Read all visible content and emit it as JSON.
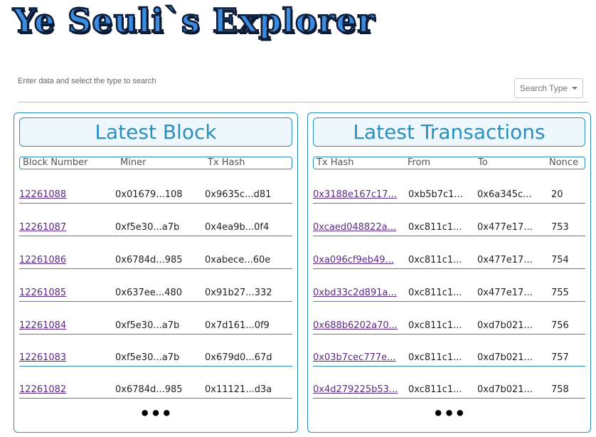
{
  "logo": "Ye Seuli`s Explorer",
  "search": {
    "hint": "Enter data and select the type to search",
    "type_label": "Search Type"
  },
  "blocks": {
    "title": "Latest Block",
    "headers": [
      "Block Number",
      "Miner",
      "Tx Hash"
    ],
    "rows": [
      {
        "number": "12261088",
        "miner": "0x01679...108",
        "tx": "0x9635c...d81"
      },
      {
        "number": "12261087",
        "miner": "0xf5e30...a7b",
        "tx": "0x4ea9b...0f4"
      },
      {
        "number": "12261086",
        "miner": "0x6784d...985",
        "tx": "0xabece...60e"
      },
      {
        "number": "12261085",
        "miner": "0x637ee...480",
        "tx": "0x91b27...332"
      },
      {
        "number": "12261084",
        "miner": "0xf5e30...a7b",
        "tx": "0x7d161...0f9"
      },
      {
        "number": "12261083",
        "miner": "0xf5e30...a7b",
        "tx": "0x679d0...67d"
      },
      {
        "number": "12261082",
        "miner": "0x6784d...985",
        "tx": "0x11121...d3a"
      }
    ],
    "more": "•••"
  },
  "transactions": {
    "title": "Latest Transactions",
    "headers": [
      "Tx Hash",
      "From",
      "To",
      "Nonce"
    ],
    "rows": [
      {
        "hash": "0x3188e167c17...",
        "from": "0xb5b7c1...",
        "to": "0x6a345c...",
        "nonce": "20"
      },
      {
        "hash": "0xcaed048822a...",
        "from": "0xc811c1...",
        "to": "0x477e17...",
        "nonce": "753"
      },
      {
        "hash": "0xa096cf9eb49...",
        "from": "0xc811c1...",
        "to": "0x477e17...",
        "nonce": "754"
      },
      {
        "hash": "0xbd33c2d891a...",
        "from": "0xc811c1...",
        "to": "0x477e17...",
        "nonce": "755"
      },
      {
        "hash": "0x688b6202a70...",
        "from": "0xc811c1...",
        "to": "0xd7b021...",
        "nonce": "756"
      },
      {
        "hash": "0x03b7cec777e...",
        "from": "0xc811c1...",
        "to": "0xd7b021...",
        "nonce": "757"
      },
      {
        "hash": "0x4d279225b53...",
        "from": "0xc811c1...",
        "to": "0xd7b021...",
        "nonce": "758"
      }
    ],
    "more": "•••"
  }
}
